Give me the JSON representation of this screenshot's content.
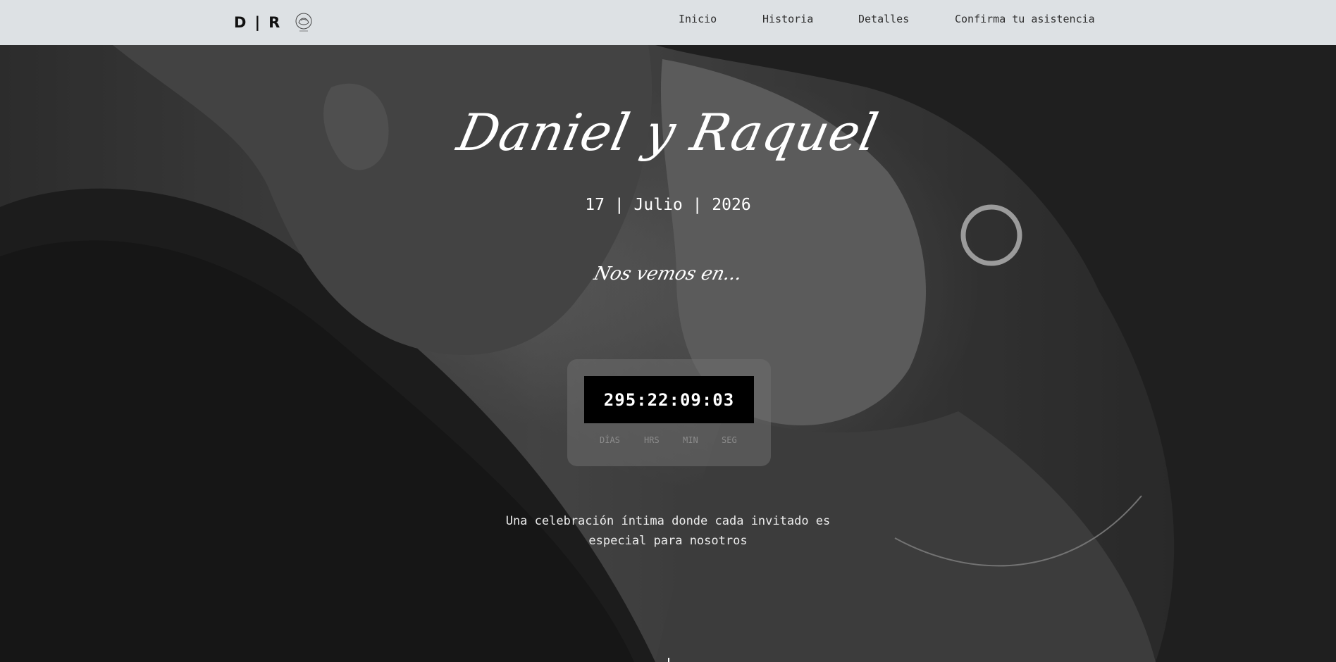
{
  "header": {
    "brand": {
      "initial_left": "D",
      "separator": "|",
      "initial_right": "R",
      "crest_icon": "wedding-crest-icon"
    },
    "nav": [
      {
        "label": "Inicio"
      },
      {
        "label": "Historia"
      },
      {
        "label": "Detalles"
      },
      {
        "label": "Confirma tu asistencia"
      }
    ]
  },
  "hero": {
    "names": "Daniel y Raquel",
    "date": "17 | Julio | 2026",
    "see_you": "Nos vemos en...",
    "countdown": {
      "value": "295:22:09:03",
      "units": [
        "DÍAS",
        "HRS",
        "MIN",
        "SEG"
      ]
    },
    "tagline": "Una celebración íntima donde cada invitado es especial para nosotros",
    "scroll_icon": "scroll-down-indicator-icon"
  },
  "colors": {
    "header_bg": "#dde1e4",
    "text_light": "#ffffff",
    "countdown_bg": "#000000"
  }
}
